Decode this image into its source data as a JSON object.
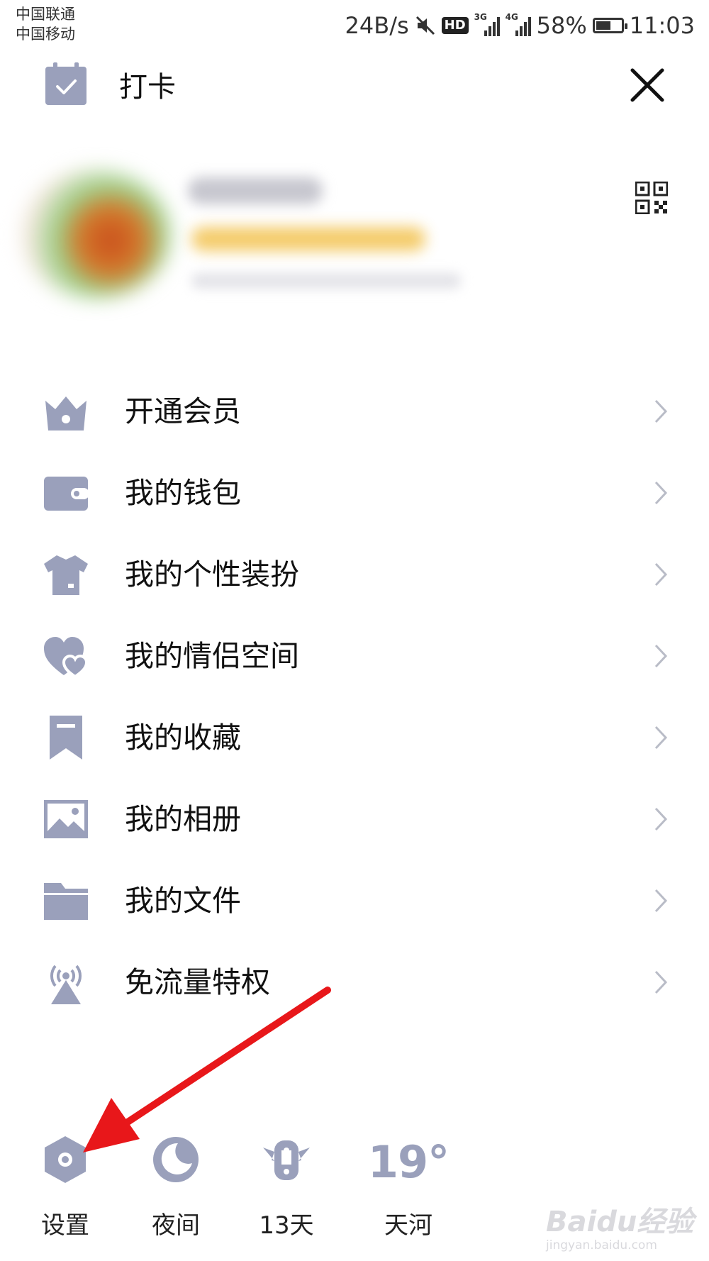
{
  "status_bar": {
    "carrier_1": "中国联通",
    "carrier_2": "中国移动",
    "net_speed": "24B/s",
    "hd_badge": "HD",
    "net_3g": "3G",
    "net_4g": "4G",
    "battery_text": "58%",
    "battery_level": 0.58,
    "time": "11:03",
    "icons": [
      "mute-icon",
      "signal-icon",
      "battery-icon"
    ]
  },
  "header": {
    "checkin_label": "打卡",
    "checkin_icon": "calendar-check-icon",
    "close_icon": "close-icon",
    "qr_icon": "qr-code-icon"
  },
  "menu": {
    "items": [
      {
        "label": "开通会员",
        "icon": "crown-icon"
      },
      {
        "label": "我的钱包",
        "icon": "wallet-icon"
      },
      {
        "label": "我的个性装扮",
        "icon": "shirt-icon"
      },
      {
        "label": "我的情侣空间",
        "icon": "hearts-icon"
      },
      {
        "label": "我的收藏",
        "icon": "bookmark-icon"
      },
      {
        "label": "我的相册",
        "icon": "image-icon"
      },
      {
        "label": "我的文件",
        "icon": "folder-icon"
      },
      {
        "label": "免流量特权",
        "icon": "broadcast-icon"
      }
    ]
  },
  "bottom_bar": {
    "settings_label": "设置",
    "night_label": "夜间",
    "days_label": "13天",
    "temperature": "19°",
    "weather_label": "天河"
  },
  "watermark": {
    "brand": "Baidu经验",
    "url": "jingyan.baidu.com"
  },
  "colors": {
    "icon": "#9aa0bb",
    "chevron": "#b9bcc7",
    "annotation_arrow": "#e8171a"
  }
}
